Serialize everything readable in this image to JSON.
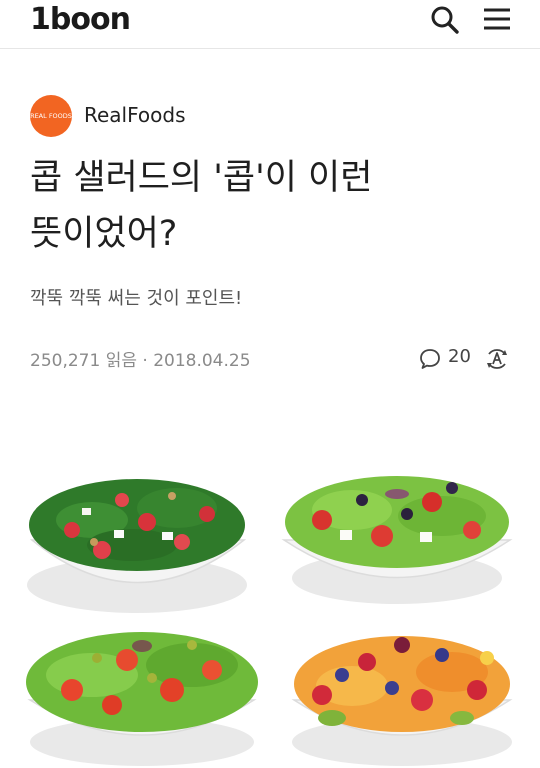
{
  "header": {
    "logo": "1boon",
    "search_icon": "search-icon",
    "menu_icon": "menu-icon"
  },
  "author": {
    "avatar_text": "REAL FOODS",
    "name": "RealFoods",
    "avatar_color": "#f26522"
  },
  "article": {
    "title_line1": "콥 샐러드의 '콥'이 이런",
    "title_line2": "뜻이었어?",
    "subtitle": "깍뚝 깍뚝 써는 것이 포인트!",
    "views": "250,271 읽음",
    "separator": "·",
    "date": "2018.04.25",
    "comment_count": "20",
    "comment_icon": "comment-icon",
    "font_size_icon": "font-size-icon"
  },
  "image": {
    "description_icon": "salad-bowls-image"
  }
}
